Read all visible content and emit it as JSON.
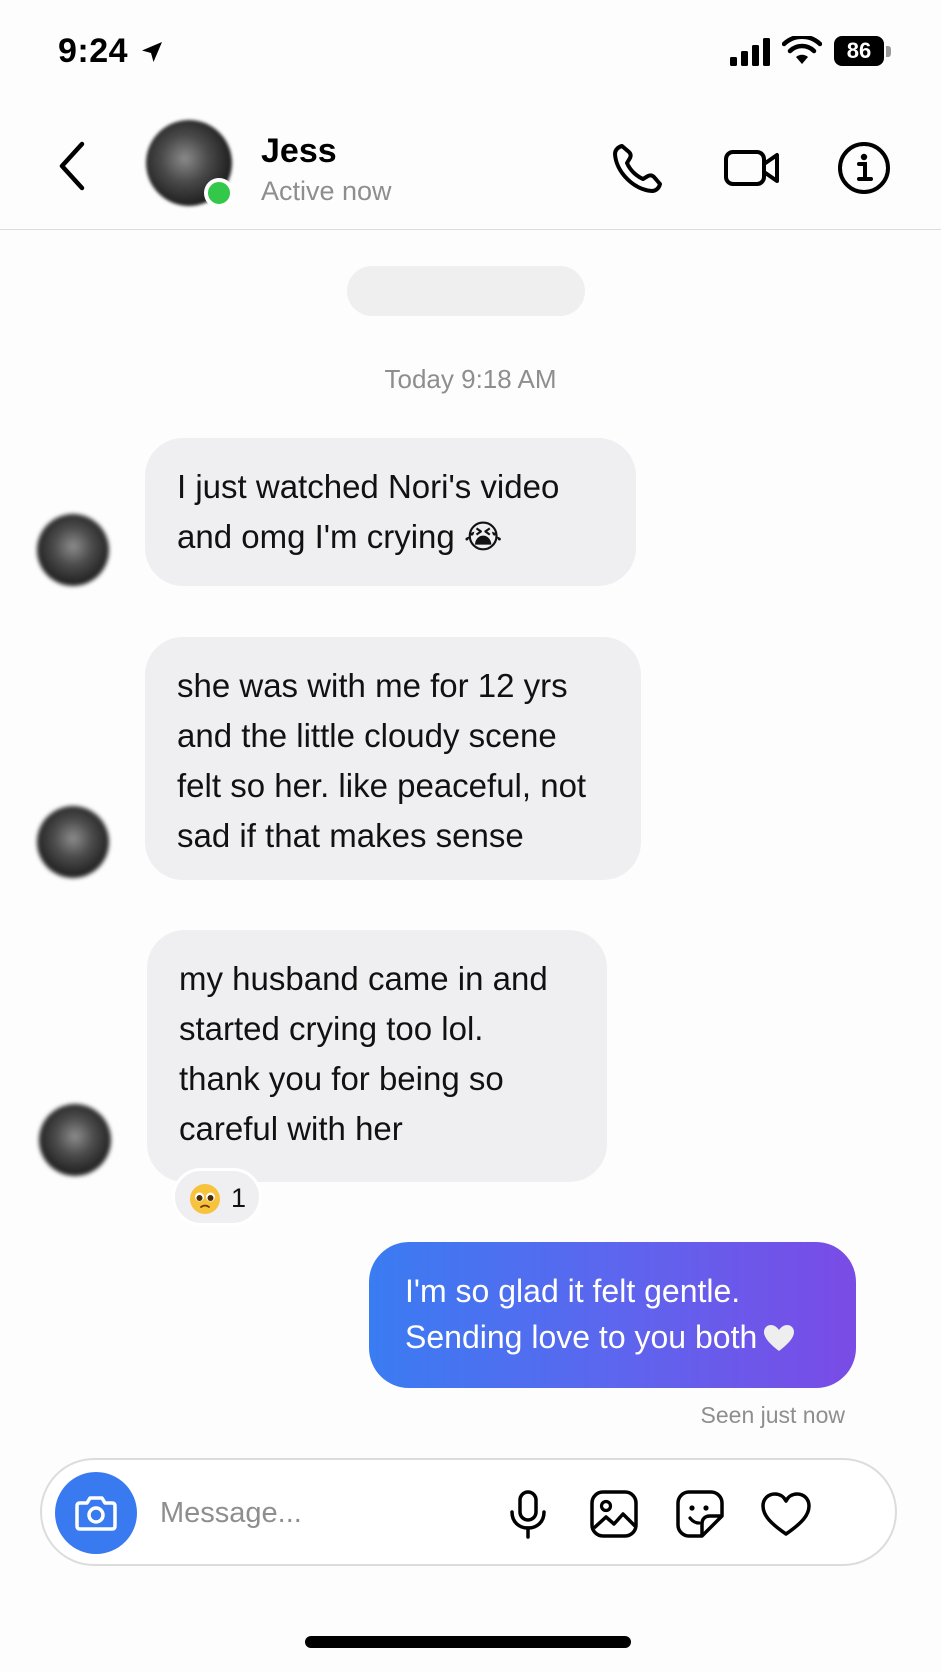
{
  "status_bar": {
    "time": "9:24",
    "battery": "86"
  },
  "header": {
    "contact_name": "Jess",
    "contact_status": "Active now",
    "icons": [
      "back-icon",
      "phone-icon",
      "video-camera-icon",
      "info-icon"
    ]
  },
  "chat": {
    "timestamp": "Today 9:18 AM",
    "incoming": [
      {
        "lines": [
          "I just watched Nori's video",
          "and omg I'm crying 😭"
        ]
      },
      {
        "lines": [
          "she was with me for 12 yrs",
          "and the little cloudy scene",
          "felt so her. like peaceful, not",
          "sad if that makes sense"
        ]
      },
      {
        "lines": [
          "my husband came in and",
          "started crying too lol.",
          "thank you for being so",
          "careful with her"
        ]
      }
    ],
    "reaction": {
      "emoji": "🥺",
      "count": "1"
    },
    "outgoing": {
      "lines": [
        "I'm so glad it felt gentle.",
        "Sending love to you both"
      ]
    },
    "seen": "Seen just now"
  },
  "composer": {
    "placeholder": "Message...",
    "icons": [
      "camera-icon",
      "microphone-icon",
      "gallery-icon",
      "sticker-icon",
      "heart-icon"
    ]
  },
  "colors": {
    "accent_blue": "#3a7af0",
    "gradient_start": "#3a7cf2",
    "gradient_end": "#7a4be6",
    "online_green": "#34c84a",
    "incoming_bubble": "#efeff1"
  }
}
